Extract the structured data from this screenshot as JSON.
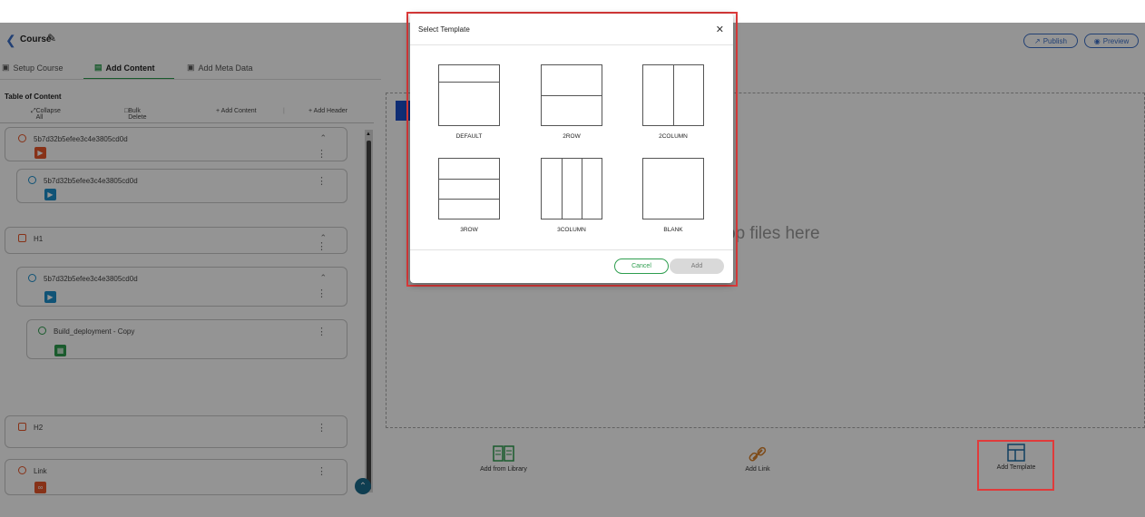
{
  "header": {
    "back_icon": "chevron-left-icon",
    "course_title": "Course",
    "publish_label": "Publish",
    "preview_label": "Preview"
  },
  "tabs": [
    {
      "label": "Setup Course",
      "icon": "monitor-icon",
      "active": false
    },
    {
      "label": "Add Content",
      "icon": "document-icon",
      "active": true
    },
    {
      "label": "Add Meta Data",
      "icon": "monitor-icon",
      "active": false
    }
  ],
  "toc": {
    "title": "Table of Content",
    "collapse_all": "Collapse All",
    "bulk_delete": "Bulk Delete",
    "add_content": "+ Add Content",
    "add_header": "+ Add Header",
    "items": [
      {
        "label": "5b7d32b5efee3c4e3805cd0d",
        "color": "#e8572a"
      },
      {
        "label": "5b7d32b5efee3c4e3805cd0d",
        "color": "#1d8fcc"
      },
      {
        "label": "H1",
        "color": "#e8572a"
      },
      {
        "label": "5b7d32b5efee3c4e3805cd0d",
        "color": "#1d8fcc"
      },
      {
        "label": "Build_deployment - Copy",
        "color": "#2e9e4f"
      },
      {
        "label": "H2",
        "color": "#e8572a"
      },
      {
        "label": "Link",
        "color": "#e8572a"
      }
    ]
  },
  "dropzone": {
    "text": "op files here"
  },
  "bottom_actions": {
    "library": "Add from Library",
    "link": "Add Link",
    "template": "Add Template"
  },
  "modal": {
    "title": "Select Template",
    "templates": [
      "DEFAULT",
      "2ROW",
      "2COLUMN",
      "3ROW",
      "3COLUMN",
      "BLANK"
    ],
    "cancel_label": "Cancel",
    "add_label": "Add"
  },
  "colors": {
    "accent_green": "#2e9e4f",
    "accent_blue": "#3b6fc8",
    "highlight_red": "#e03b3b"
  }
}
